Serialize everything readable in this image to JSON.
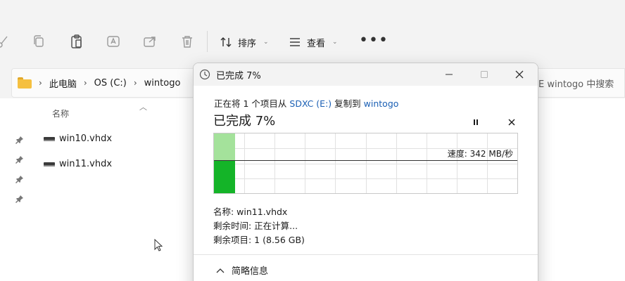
{
  "toolbar": {
    "sort_label": "排序",
    "view_label": "查看",
    "more_label": "•••"
  },
  "address": {
    "crumbs": [
      "此电脑",
      "OS (C:)",
      "wintogo"
    ],
    "search_placeholder": "E wintogo 中搜索"
  },
  "list": {
    "column_name": "名称",
    "files": [
      {
        "name": "win10.vhdx"
      },
      {
        "name": "win11.vhdx"
      }
    ]
  },
  "dialog": {
    "window_title": "已完成 7%",
    "from_prefix": "正在将 1 个项目从",
    "source": "SDXC (E:)",
    "copy_to": "复制到",
    "destination": "wintogo",
    "status": "已完成 7%",
    "progress_percent": 7,
    "speed_label": "速度: 342 MB/秒",
    "speed_fraction_of_graph": 0.45,
    "name_line": "名称: win11.vhdx",
    "time_left_line": "剩余时间: 正在计算...",
    "items_left_line": "剩余项目: 1 (8.56 GB)",
    "details_toggle": "简略信息"
  },
  "colors": {
    "progress_done": "#a4e29b",
    "speed_fill": "#14b428",
    "link": "#1a5fb4",
    "folder": "#f5c040"
  }
}
